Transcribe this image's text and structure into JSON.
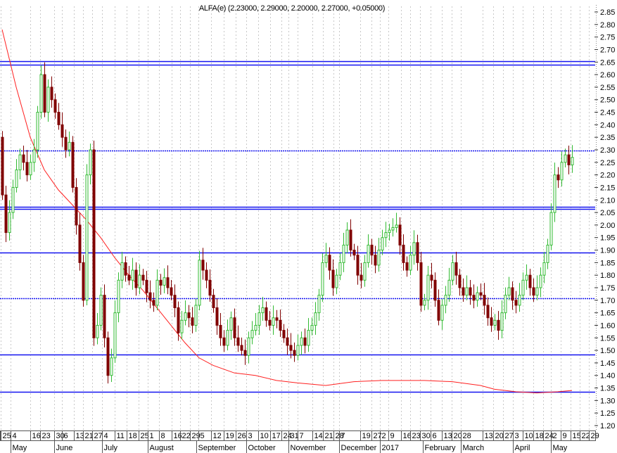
{
  "chart_data": {
    "type": "candlestick",
    "title": "ALFA(e) (2.23000, 2.29000, 2.20000, 2.27000, +0.05000)",
    "ylim": [
      1.2,
      2.85
    ],
    "yticks": [
      "2.85",
      "2.80",
      "2.75",
      "2.70",
      "2.65",
      "2.60",
      "2.55",
      "2.50",
      "2.45",
      "2.40",
      "2.35",
      "2.30",
      "2.25",
      "2.20",
      "2.15",
      "2.10",
      "2.05",
      "2.00",
      "1.95",
      "1.90",
      "1.85",
      "1.80",
      "1.75",
      "1.70",
      "1.65",
      "1.60",
      "1.55",
      "1.50",
      "1.45",
      "1.40",
      "1.35",
      "1.30",
      "1.25",
      "1.20"
    ],
    "first_open": 2.35,
    "closes": [
      2.12,
      1.97,
      2.05,
      2.15,
      2.22,
      2.28,
      2.25,
      2.2,
      2.25,
      2.3,
      2.45,
      2.6,
      2.45,
      2.55,
      2.5,
      2.45,
      2.4,
      2.35,
      2.3,
      2.33,
      2.15,
      2.0,
      1.85,
      1.7,
      2.2,
      2.3,
      1.55,
      1.6,
      1.72,
      1.55,
      1.4,
      1.47,
      1.65,
      1.78,
      1.85,
      1.8,
      1.78,
      1.82,
      1.75,
      1.8,
      1.78,
      1.73,
      1.7,
      1.68,
      1.78,
      1.76,
      1.79,
      1.75,
      1.72,
      1.67,
      1.57,
      1.62,
      1.65,
      1.63,
      1.6,
      1.68,
      1.86,
      1.82,
      1.78,
      1.72,
      1.67,
      1.6,
      1.55,
      1.52,
      1.58,
      1.63,
      1.55,
      1.52,
      1.5,
      1.48,
      1.55,
      1.58,
      1.6,
      1.65,
      1.67,
      1.62,
      1.6,
      1.63,
      1.62,
      1.58,
      1.55,
      1.52,
      1.5,
      1.48,
      1.52,
      1.55,
      1.52,
      1.58,
      1.6,
      1.65,
      1.72,
      1.85,
      1.88,
      1.82,
      1.75,
      1.8,
      1.85,
      1.92,
      1.98,
      1.9,
      1.88,
      1.8,
      1.78,
      1.85,
      1.92,
      1.88,
      1.84,
      1.9,
      1.95,
      1.97,
      1.98,
      1.99,
      2.0,
      1.92,
      1.85,
      1.82,
      1.88,
      1.93,
      1.85,
      1.68,
      1.7,
      1.8,
      1.78,
      1.7,
      1.62,
      1.68,
      1.72,
      1.78,
      1.85,
      1.8,
      1.75,
      1.72,
      1.75,
      1.72,
      1.7,
      1.73,
      1.72,
      1.68,
      1.63,
      1.6,
      1.62,
      1.58,
      1.65,
      1.72,
      1.75,
      1.7,
      1.68,
      1.72,
      1.78,
      1.8,
      1.75,
      1.72,
      1.75,
      1.8,
      1.85,
      1.92,
      2.05,
      2.2,
      2.18,
      2.25,
      2.28,
      2.24,
      2.27
    ],
    "moving_average": [
      [
        0,
        2.78
      ],
      [
        4,
        2.55
      ],
      [
        8,
        2.35
      ],
      [
        12,
        2.22
      ],
      [
        16,
        2.14
      ],
      [
        20,
        2.08
      ],
      [
        24,
        2.02
      ],
      [
        28,
        1.95
      ],
      [
        32,
        1.87
      ],
      [
        36,
        1.8
      ],
      [
        40,
        1.74
      ],
      [
        44,
        1.67
      ],
      [
        48,
        1.6
      ],
      [
        52,
        1.53
      ],
      [
        56,
        1.47
      ],
      [
        60,
        1.44
      ],
      [
        66,
        1.41
      ],
      [
        72,
        1.4
      ],
      [
        78,
        1.38
      ],
      [
        84,
        1.37
      ],
      [
        92,
        1.36
      ],
      [
        100,
        1.375
      ],
      [
        108,
        1.38
      ],
      [
        120,
        1.38
      ],
      [
        128,
        1.375
      ],
      [
        136,
        1.36
      ],
      [
        140,
        1.345
      ],
      [
        146,
        1.335
      ],
      [
        152,
        1.33
      ],
      [
        158,
        1.335
      ],
      [
        162,
        1.34
      ]
    ],
    "horizontal_lines": [
      {
        "value": 2.654,
        "style": "solid"
      },
      {
        "value": 2.64,
        "style": "solid"
      },
      {
        "value": 2.297,
        "style": "dotted"
      },
      {
        "value": 2.073,
        "style": "solid"
      },
      {
        "value": 2.064,
        "style": "solid"
      },
      {
        "value": 1.89,
        "style": "solid"
      },
      {
        "value": 1.708,
        "style": "dotted"
      },
      {
        "value": 1.484,
        "style": "solid"
      },
      {
        "value": 1.335,
        "style": "solid"
      }
    ],
    "xticks": [
      {
        "label": "25",
        "idx": -0.4
      },
      {
        "label": "4",
        "idx": 2.4
      },
      {
        "label": "16",
        "idx": 8
      },
      {
        "label": "23",
        "idx": 10.8
      },
      {
        "label": "30",
        "idx": 14.8
      },
      {
        "label": "6",
        "idx": 17
      },
      {
        "label": "13",
        "idx": 20.4
      },
      {
        "label": "21",
        "idx": 23
      },
      {
        "label": "27",
        "idx": 25.6
      },
      {
        "label": "4",
        "idx": 28.4
      },
      {
        "label": "11",
        "idx": 32
      },
      {
        "label": "18",
        "idx": 35.4
      },
      {
        "label": "25",
        "idx": 38.8
      },
      {
        "label": "1",
        "idx": 41.4
      },
      {
        "label": "8",
        "idx": 44.6
      },
      {
        "label": "16",
        "idx": 48.2
      },
      {
        "label": "22",
        "idx": 50.6
      },
      {
        "label": "29",
        "idx": 53.4
      },
      {
        "label": "5",
        "idx": 55.8
      },
      {
        "label": "12",
        "idx": 59.4
      },
      {
        "label": "19",
        "idx": 63
      },
      {
        "label": "26",
        "idx": 66.4
      },
      {
        "label": "3",
        "idx": 69.4
      },
      {
        "label": "10",
        "idx": 72.8
      },
      {
        "label": "17",
        "idx": 76.2
      },
      {
        "label": "24",
        "idx": 79.4
      },
      {
        "label": "31",
        "idx": 81.4
      },
      {
        "label": "7",
        "idx": 84
      },
      {
        "label": "14",
        "idx": 88.2
      },
      {
        "label": "21",
        "idx": 91.2
      },
      {
        "label": "28",
        "idx": 94.2
      },
      {
        "label": "7",
        "idx": 95.8
      },
      {
        "label": "19",
        "idx": 101.8
      },
      {
        "label": "27",
        "idx": 105
      },
      {
        "label": "2",
        "idx": 107.4
      },
      {
        "label": "9",
        "idx": 109.8
      },
      {
        "label": "16",
        "idx": 113.4
      },
      {
        "label": "23",
        "idx": 116
      },
      {
        "label": "30",
        "idx": 118.8
      },
      {
        "label": "6",
        "idx": 121.8
      },
      {
        "label": "13",
        "idx": 125
      },
      {
        "label": "20",
        "idx": 127.8
      },
      {
        "label": "28",
        "idx": 130.4
      },
      {
        "label": "13",
        "idx": 136.6
      },
      {
        "label": "20",
        "idx": 139.6
      },
      {
        "label": "27",
        "idx": 142.4
      },
      {
        "label": "3",
        "idx": 145.2
      },
      {
        "label": "10",
        "idx": 148
      },
      {
        "label": "18",
        "idx": 151
      },
      {
        "label": "24",
        "idx": 153.8
      },
      {
        "label": "2",
        "idx": 156
      },
      {
        "label": "9",
        "idx": 158.8
      },
      {
        "label": "15",
        "idx": 161.6
      },
      {
        "label": "22",
        "idx": 164.2
      },
      {
        "label": "29",
        "idx": 166.8
      }
    ],
    "months": [
      {
        "label": "May",
        "idx": 2.4
      },
      {
        "label": "June",
        "idx": 14.8
      },
      {
        "label": "July",
        "idx": 28.4
      },
      {
        "label": "August",
        "idx": 41.4
      },
      {
        "label": "September",
        "idx": 55.2
      },
      {
        "label": "October",
        "idx": 69.4
      },
      {
        "label": "November",
        "idx": 81.4
      },
      {
        "label": "December",
        "idx": 95.8
      },
      {
        "label": "2017",
        "idx": 107.4
      },
      {
        "label": "February",
        "idx": 119.6
      },
      {
        "label": "March",
        "idx": 130.4
      },
      {
        "label": "April",
        "idx": 145.2
      },
      {
        "label": "May",
        "idx": 156
      }
    ],
    "colors": {
      "up": "#33bb33",
      "down": "#800000",
      "ma": "#ff2020",
      "hline": "#1414f0",
      "grid": "#c8c8c8"
    }
  }
}
